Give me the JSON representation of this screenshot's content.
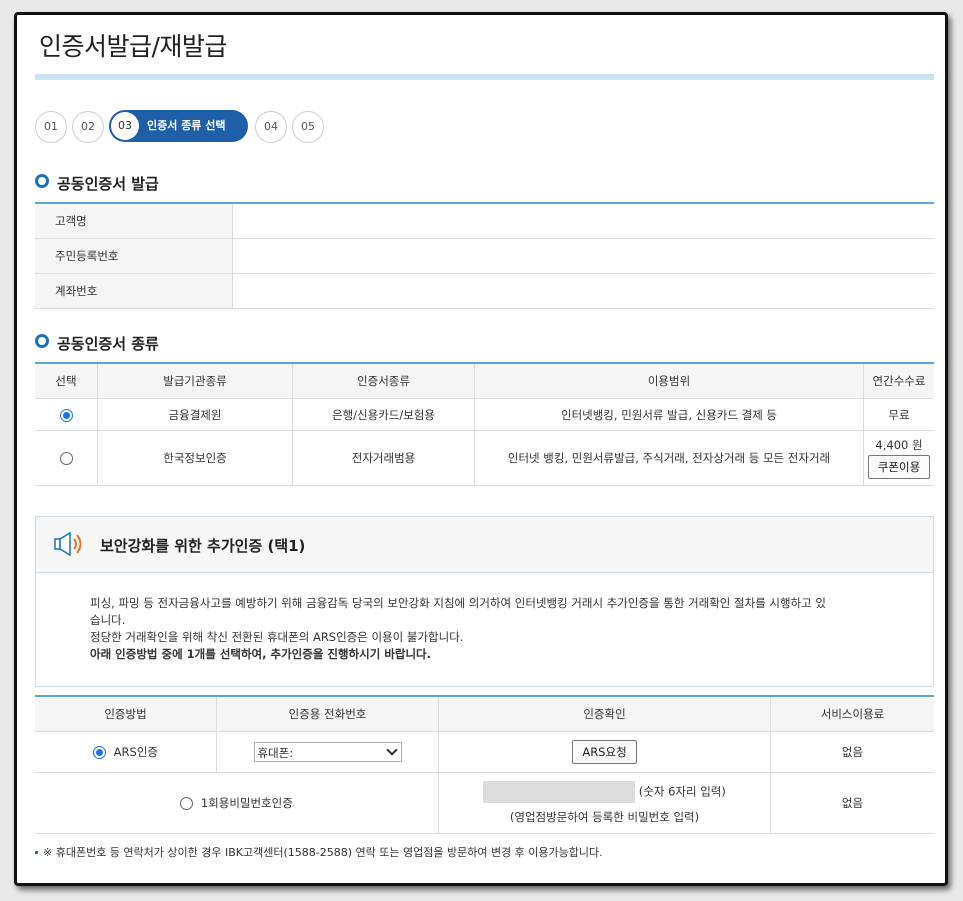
{
  "page": {
    "title": "인증서발급/재발급"
  },
  "steps": [
    {
      "num": "01"
    },
    {
      "num": "02"
    },
    {
      "num": "03",
      "label": "인증서 종류 선택",
      "active": true
    },
    {
      "num": "04"
    },
    {
      "num": "05"
    }
  ],
  "info_section": {
    "title": "공동인증서 발급",
    "rows": [
      {
        "label": "고객명",
        "value": ""
      },
      {
        "label": "주민등록번호",
        "value": ""
      },
      {
        "label": "계좌번호",
        "value": ""
      }
    ]
  },
  "type_section": {
    "title": "공동인증서 종류",
    "headers": [
      "선택",
      "발급기관종류",
      "인증서종류",
      "이용범위",
      "연간수수료"
    ],
    "rows": [
      {
        "selected": true,
        "issuer": "금융결제원",
        "cert_type": "은행/신용카드/보험용",
        "scope": "인터넷뱅킹, 민원서류 발급, 신용카드 결제 등",
        "fee": "무료"
      },
      {
        "selected": false,
        "issuer": "한국정보인증",
        "cert_type": "전자거래범용",
        "scope": "인터넷 뱅킹, 민원서류발급, 주식거래, 전자상거래 등 모든 전자거래",
        "fee": "4,400 원",
        "coupon_button": "쿠폰이용"
      }
    ]
  },
  "notice": {
    "icon": "speaker-icon",
    "title": "보안강화를 위한 추가인증 (택1)",
    "line1": "피싱, 파밍 등 전자금융사고를 예방하기 위해 금융감독 당국의 보안강화 지침에 의거하여 인터넷뱅킹 거래시 추가인증을 통한 거래확인 절차를 시행하고 있",
    "line2": "습니다.",
    "line3": "정당한 거래확인을 위해 착신 전환된 휴대폰의 ARS인증은 이용이 불가합니다.",
    "line4": "아래 인증방법 중에 1개를 선택하여, 추가인증을 진행하시기 바랍니다."
  },
  "auth_section": {
    "headers": [
      "인증방법",
      "인증용 전화번호",
      "인증확인",
      "서비스이용료"
    ],
    "ars": {
      "label": "ARS인증",
      "selected": true,
      "phone_select": "휴대폰:",
      "button": "ARS요청",
      "fee": "없음"
    },
    "otp": {
      "label": "1회용비밀번호인증",
      "selected": false,
      "hint1": "(숫자 6자리 입력)",
      "hint2": "(영업점방문하여 등록한 비밀번호 입력)",
      "fee": "없음"
    }
  },
  "footnote": "※ 휴대폰번호 등 연락처가 상이한 경우 IBK고객센터(1588-2588) 연락 또는 영업점을 방문하여 변경 후 이용가능합니다.",
  "colors": {
    "accent": "#1f5fa8",
    "table_top_border": "#5aa6d8",
    "title_bar": "#c9e3f3"
  }
}
